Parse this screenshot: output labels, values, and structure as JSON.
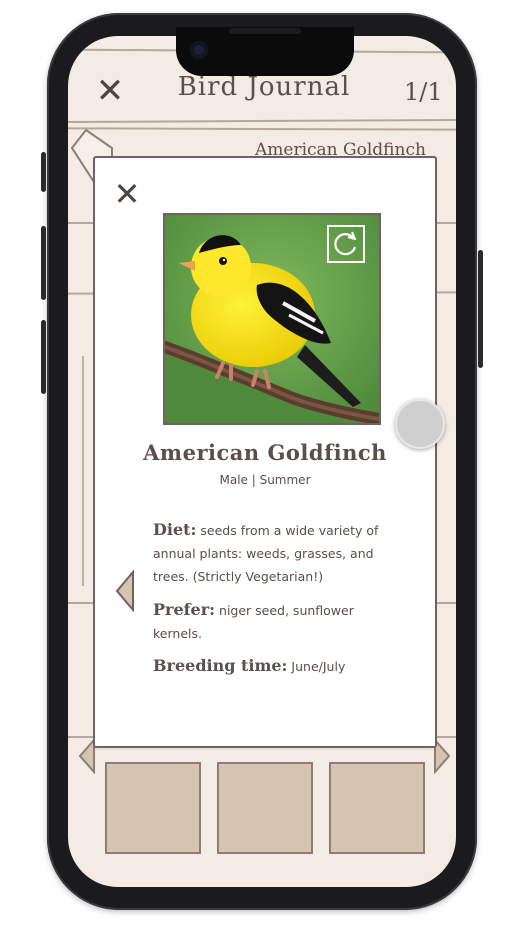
{
  "header": {
    "close_symbol": "✕",
    "title": "Bird Journal",
    "page_indicator": "1/1"
  },
  "background": {
    "entry_name": "American Goldfinch"
  },
  "card": {
    "close_symbol": "✕",
    "bird_name": "American Goldfinch",
    "subtitle": "Male | Summer",
    "diet_label": "Diet:",
    "diet_text": " seeds from a wide variety of annual plants: weeds, grasses, and trees. (Strictly Vegetarian!)",
    "prefer_label": "Prefer:",
    "prefer_text": " niger seed, sunflower kernels.",
    "breeding_label": "Breeding time:",
    "breeding_text": " June/July",
    "photo_icon": "rotate-icon",
    "nav_icon": "left-arrow-icon"
  },
  "colors": {
    "paper": "#f4ece4",
    "ink": "#5b4e4b",
    "slot": "#d6c4b3"
  }
}
